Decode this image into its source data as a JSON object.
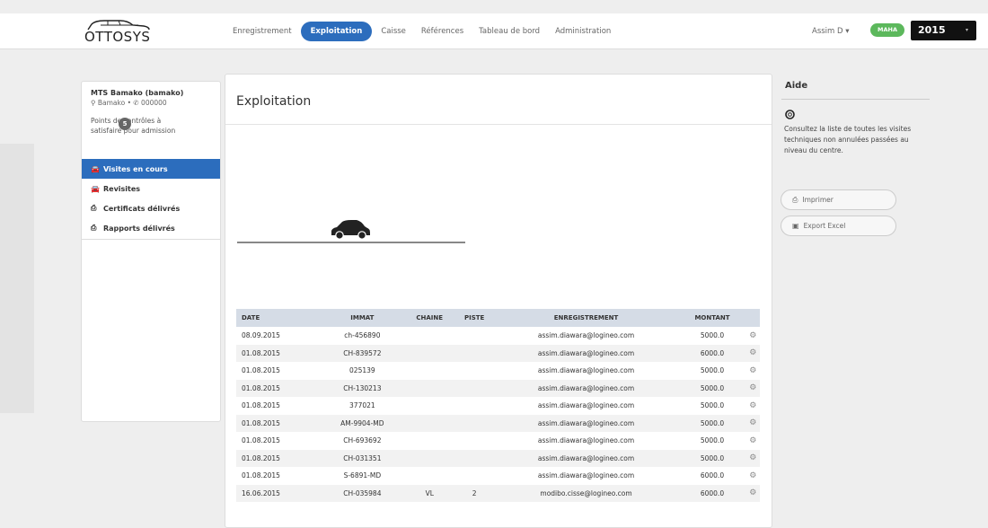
{
  "app": {
    "logo_text": "OTTOSYS"
  },
  "nav": {
    "items": [
      {
        "label": "Enregistrement",
        "active": false
      },
      {
        "label": "Exploitation",
        "active": true
      },
      {
        "label": "Caisse",
        "active": false
      },
      {
        "label": "Références",
        "active": false
      },
      {
        "label": "Tableau de bord",
        "active": false
      },
      {
        "label": "Administration",
        "active": false
      }
    ]
  },
  "user": {
    "name": "Assim D ▾",
    "badge": "MAHA",
    "year": "2015",
    "year_caret": "▾"
  },
  "sidebar": {
    "org_name": "MTS Bamako (bamako)",
    "org_location": "⚲ Bamako • ✆ 000000",
    "points_label": "Points de contrôles à satisfaire pour admission",
    "points_count": "5",
    "items": [
      {
        "label": "Visites en cours",
        "icon": "car-icon",
        "glyph": "🚘",
        "active": true
      },
      {
        "label": "Revisites",
        "icon": "car-icon",
        "glyph": "🚘",
        "active": false
      },
      {
        "label": "Certificats délivrés",
        "icon": "print-icon",
        "glyph": "⎙",
        "active": false
      },
      {
        "label": "Rapports délivrés",
        "icon": "print-icon",
        "glyph": "⎙",
        "active": false
      }
    ]
  },
  "main": {
    "title": "Exploitation",
    "table": {
      "headers": [
        "DATE",
        "IMMAT",
        "CHAINE",
        "PISTE",
        "ENREGISTREMENT",
        "MONTANT",
        ""
      ],
      "rows": [
        [
          "08.09.2015",
          "ch-456890",
          "",
          "",
          "assim.diawara@logineo.com",
          "5000.0"
        ],
        [
          "01.08.2015",
          "CH-839572",
          "",
          "",
          "assim.diawara@logineo.com",
          "6000.0"
        ],
        [
          "01.08.2015",
          "025139",
          "",
          "",
          "assim.diawara@logineo.com",
          "5000.0"
        ],
        [
          "01.08.2015",
          "CH-130213",
          "",
          "",
          "assim.diawara@logineo.com",
          "5000.0"
        ],
        [
          "01.08.2015",
          "377021",
          "",
          "",
          "assim.diawara@logineo.com",
          "5000.0"
        ],
        [
          "01.08.2015",
          "AM-9904-MD",
          "",
          "",
          "assim.diawara@logineo.com",
          "5000.0"
        ],
        [
          "01.08.2015",
          "CH-693692",
          "",
          "",
          "assim.diawara@logineo.com",
          "5000.0"
        ],
        [
          "01.08.2015",
          "CH-031351",
          "",
          "",
          "assim.diawara@logineo.com",
          "5000.0"
        ],
        [
          "01.08.2015",
          "S-6891-MD",
          "",
          "",
          "assim.diawara@logineo.com",
          "6000.0"
        ],
        [
          "16.06.2015",
          "CH-035984",
          "VL",
          "2",
          "modibo.cisse@logineo.com",
          "6000.0"
        ]
      ],
      "row_action_icon": "⚙"
    }
  },
  "help": {
    "title": "Aide",
    "text": "Consultez la liste de toutes les visites techniques non annulées passées au niveau du centre.",
    "print_label": "Imprimer",
    "print_glyph": "⎙",
    "export_label": "Export Excel",
    "export_glyph": "▣"
  },
  "colors": {
    "primary": "#2c6dbd",
    "badge_green": "#5cb85c",
    "dark": "#111111"
  }
}
